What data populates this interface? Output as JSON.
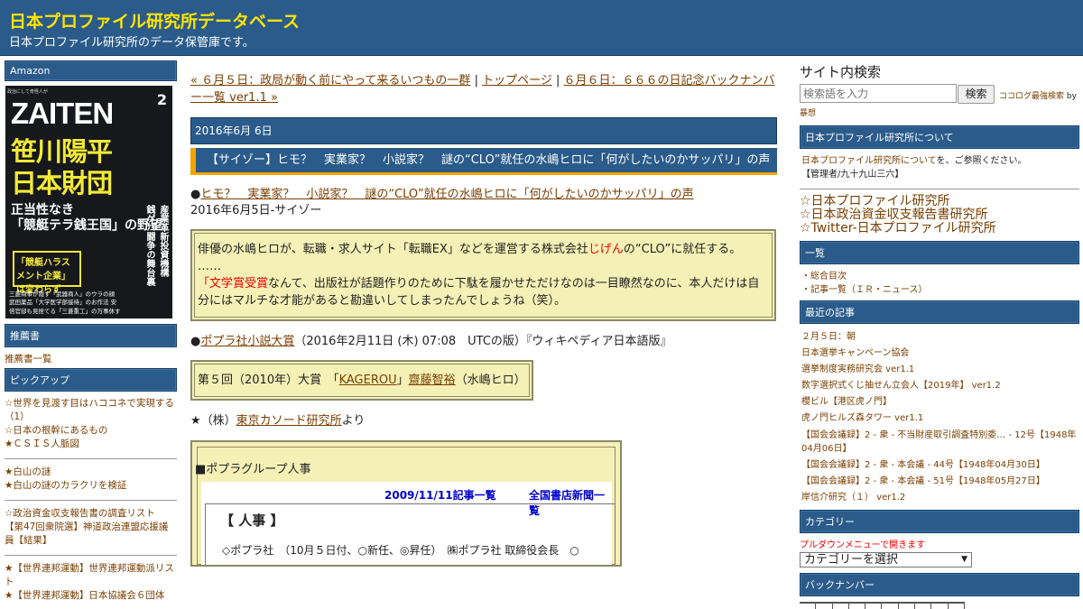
{
  "header": {
    "title": "日本プロファイル研究所データベース",
    "description": "日本プロファイル研究所のデータ保管庫です。"
  },
  "left": {
    "amazon_title": "Amazon",
    "cover": {
      "top_small": "政治にして奇怪人が",
      "logo": "ZAITEN",
      "issue": "2",
      "headline_line1": "笹川陽平",
      "headline_line2": "日本財団",
      "subhead_line1": "正当性なき",
      "subhead_line2": "「競艇テラ銭王国」の野望",
      "box_text": "「競艇ハラスメント企業」は変わらず",
      "side_text": "産業革新投資機構 銭ゲバ闘争の舞台裏",
      "bottom": "三菱商事が隠す「武器商人」のウラの顔 武田薬品「大学医学部接待」のお作法 安倍官邸も見捨てる「三菱重工」の万事休す"
    },
    "recommend_title": "推薦書",
    "recommend_items": [
      "推薦書一覧"
    ],
    "pickup_title": "ピックアップ",
    "pickup_group1": [
      "☆世界を見渡す目はハココネで実現する（1）",
      "☆日本の根幹にあるもの",
      "★ＣＳＩＳ人脈図"
    ],
    "pickup_group2": [
      "★白山の謎",
      "★白山の謎のカラクリを検証"
    ],
    "pickup_group3": [
      "☆政治資金収支報告書の調査リスト",
      "【第47回衆院選】神道政治連盟応援議員【結果】"
    ],
    "pickup_group4": [
      "★【世界連邦運動】世界連邦運動派リスト",
      "★【世界連邦運動】日本協議会６団体"
    ]
  },
  "center": {
    "nav_prev": "« ６月５日：政局が動く前にやって来るいつもの一群",
    "nav_sep1": " | ",
    "nav_top": "トップページ",
    "nav_sep2": " | ",
    "nav_next": "６月６日：６６６の日記念バックナンバー一覧 ver1.1 »",
    "date": "2016年6月 6日",
    "post_title": "【サイゾー】ヒモ？　実業家？　小説家？　謎の“CLO”就任の水嶋ヒロに「何がしたいのかサッパリ」の声",
    "bullet1_prefix": "●",
    "bullet1_link": "ヒモ？　実業家？　小説家？　謎の“CLO”就任の水嶋ヒロに「何がしたいのかサッパリ」の声",
    "bullet1_source": "2016年6月5日-サイゾー",
    "quote1_a": "俳優の水嶋ヒロが、転職・求人サイト「転職EX」などを運営する株式会社",
    "quote1_red": "じげん",
    "quote1_b": "の“CLO”に就任する。",
    "quote1_ellipsis": "……",
    "quote1_c_open": "「",
    "quote1_c_red": "文学賞受賞",
    "quote1_c": "なんて、出版社が話題作りのために下駄を履かせただけなのは一目瞭然なのに、本人だけは自分にはマルチな才能があると勘違いしてしまったんでしょうね（笑）。",
    "bullet2_prefix": "●",
    "bullet2_link": "ポプラ社小説大賞",
    "bullet2_rest": "（2016年2月11日 (木) 07:08　UTCの版）『ウィキペディア日本語版』",
    "quote2_a": "第５回（2010年）大賞　「",
    "quote2_link1": "KAGEROU",
    "quote2_b": "」",
    "quote2_link2": "齋藤智裕",
    "quote2_c": "（水嶋ヒロ）",
    "star_prefix": "★（株）",
    "star_link": "東京カソード研究所",
    "star_suffix": "より",
    "box3": {
      "heading": "■ポプラグループ人事",
      "link1": "2009/11/11記事一覧",
      "link2": "全国書店新聞一覧",
      "jinji": "【 人事 】",
      "line": "◇ポプラ社　（10月５日付、○新任、◎昇任）　㈱ポプラ社 取締役会長　○"
    }
  },
  "right": {
    "search_title": "サイト内検索",
    "search_placeholder": "検索語を入力",
    "search_button": "検索",
    "search_credit_a": "ココログ最強検索",
    "search_credit_b": " by",
    "search_credit_c": "暴想",
    "about_title": "日本プロファイル研究所について",
    "about_link": "日本プロファイル研究所について",
    "about_text": "を、ご参照ください。",
    "admin": "【管理者/九十九山三六】",
    "links": [
      "☆日本プロファイル研究所",
      "☆日本政治資金収支報告書研究所",
      "☆Twitter-日本プロファイル研究所"
    ],
    "ichiran_title": "一覧",
    "ichiran_items": [
      "・総合目次",
      "・記事一覧（ＩＲ・ニュース）"
    ],
    "recent_title": "最近の記事",
    "recent_items": [
      "２月５日：朝",
      "日本選挙キャンペーン協会",
      "選挙制度実務研究会 ver1.1",
      "数字選択式くじ抽せん立会人【2019年】 ver1.2",
      "櫻ビル【港区虎ノ門】",
      "虎ノ門ヒルズ森タワー ver1.1",
      "【国会会議録】2 - 衆 - 不当財産取引調査特別委… - 12号【1948年04月06日】",
      "【国会会議録】2 - 衆 - 本会議 - 44号【1948年04月30日】",
      "【国会会議録】2 - 衆 - 本会議 - 51号【1948年05月27日】",
      "岸信介研究（１） ver1.2"
    ],
    "category_title": "カテゴリー",
    "category_note": "プルダウンメニューで開きます",
    "category_select": "カテゴリーを選択",
    "backnumber_title": "バックナンバー"
  }
}
